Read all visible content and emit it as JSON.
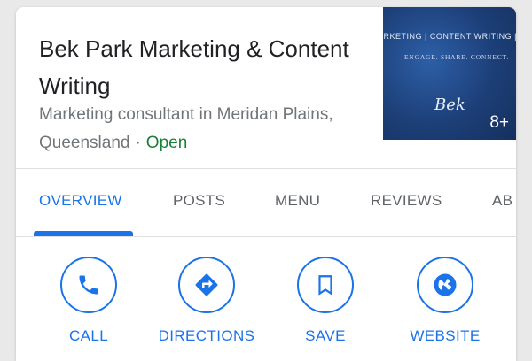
{
  "business": {
    "name": "Bek Park Marketing & Content Writing",
    "category": "Marketing consultant in Meridan Plains, Queensland",
    "separator": "·",
    "status": "Open"
  },
  "hero": {
    "banner_text": "ARKETING | CONTENT WRITING | S",
    "tagline": "ENGAGE. SHARE. CONNECT.",
    "logo_text": "Bek",
    "photo_count": "8+"
  },
  "tabs": [
    {
      "label": "OVERVIEW",
      "active": true
    },
    {
      "label": "POSTS",
      "active": false
    },
    {
      "label": "MENU",
      "active": false
    },
    {
      "label": "REVIEWS",
      "active": false
    },
    {
      "label": "AB",
      "active": false
    }
  ],
  "actions": [
    {
      "label": "CALL",
      "icon": "phone-icon"
    },
    {
      "label": "DIRECTIONS",
      "icon": "directions-icon"
    },
    {
      "label": "SAVE",
      "icon": "bookmark-icon"
    },
    {
      "label": "WEBSITE",
      "icon": "globe-icon"
    }
  ],
  "colors": {
    "accent": "#1a73e8",
    "open": "#188038",
    "text_primary": "#202124",
    "text_secondary": "#70757a",
    "tab_inactive": "#5f6368",
    "hero_bg": "#1d3f78"
  }
}
